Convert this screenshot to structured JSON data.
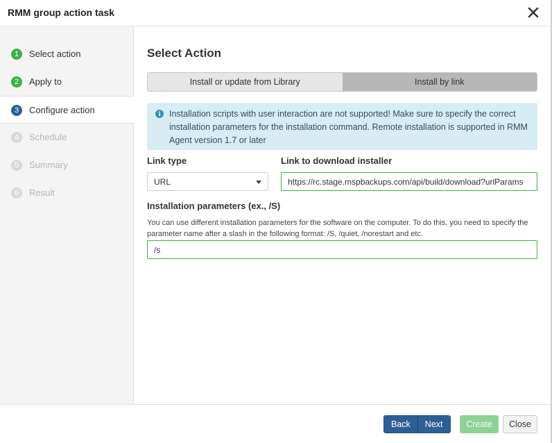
{
  "dialog": {
    "title": "RMM group action task",
    "close_icon": "close-icon"
  },
  "sidebar": {
    "steps": [
      {
        "num": "1",
        "label": "Select action",
        "state": "done"
      },
      {
        "num": "2",
        "label": "Apply to",
        "state": "done"
      },
      {
        "num": "3",
        "label": "Configure action",
        "state": "active"
      },
      {
        "num": "4",
        "label": "Schedule",
        "state": "pending"
      },
      {
        "num": "5",
        "label": "Summary",
        "state": "pending"
      },
      {
        "num": "6",
        "label": "Result",
        "state": "pending"
      }
    ]
  },
  "main": {
    "title": "Select Action",
    "tabs": [
      {
        "label": "Install or update from Library",
        "selected": false
      },
      {
        "label": "Install by link",
        "selected": true
      }
    ],
    "alert": {
      "icon": "info-icon",
      "text": "Installation scripts with user interaction are not supported! Make sure to specify the correct installation parameters for the installation command. Remote installation is supported in RMM Agent version 1.7 or later"
    },
    "link_type": {
      "label": "Link type",
      "value": "URL"
    },
    "link": {
      "label": "Link to download installer",
      "value": "https://rc.stage.mspbackups.com/api/build/download?urlParams"
    },
    "params": {
      "label": "Installation parameters (ex., /S)",
      "help": "You can use different installation parameters for the software on the computer. To do this, you need to specify the parameter name after a slash in the following format: /S, /quiet, /norestart and etc.",
      "value": "/s"
    }
  },
  "footer": {
    "back": "Back",
    "next": "Next",
    "create": "Create",
    "close": "Close"
  },
  "colors": {
    "primary": "#2d5f96",
    "success": "#3fae49",
    "info_bg": "#d8edf3"
  }
}
